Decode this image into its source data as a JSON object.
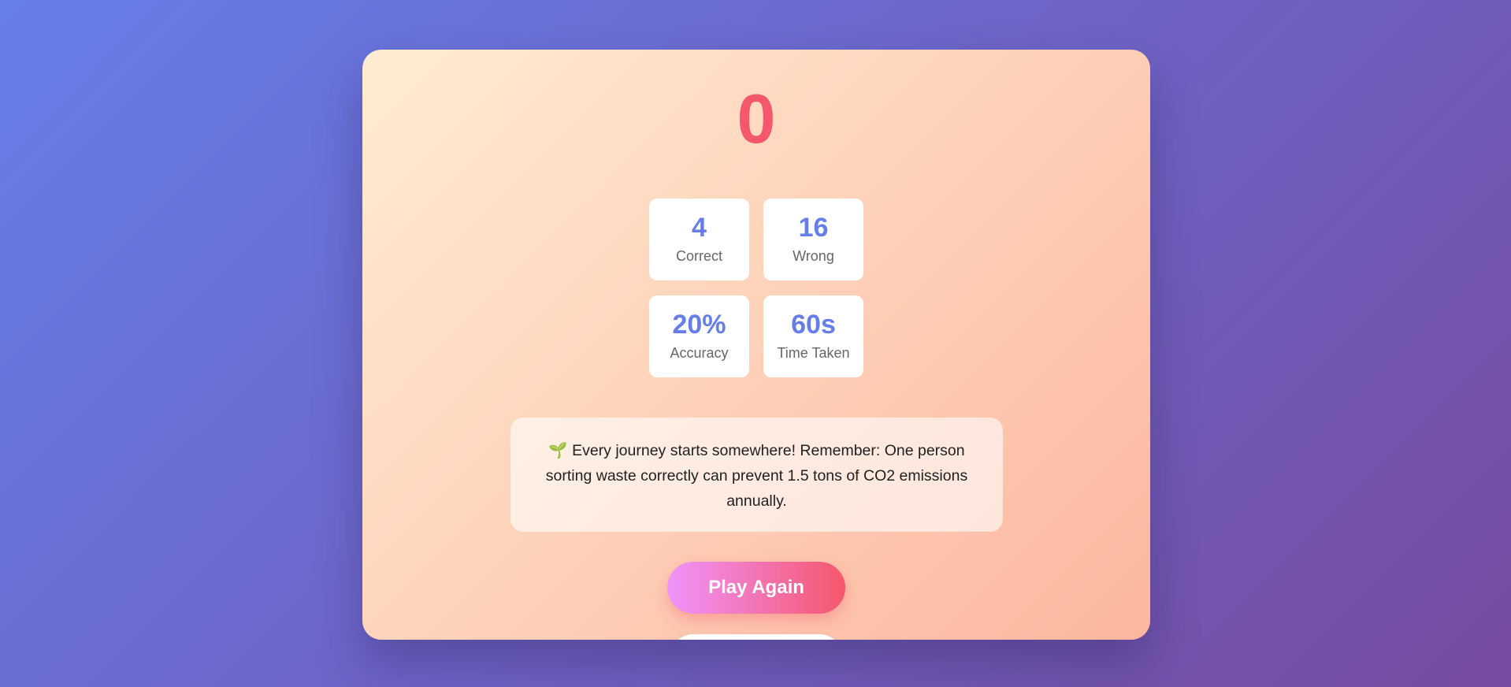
{
  "results": {
    "score": "0",
    "stats": [
      {
        "value": "4",
        "label": "Correct"
      },
      {
        "value": "16",
        "label": "Wrong"
      },
      {
        "value": "20%",
        "label": "Accuracy"
      },
      {
        "value": "60s",
        "label": "Time Taken"
      }
    ],
    "message": "🌱 Every journey starts somewhere! Remember: One person sorting waste correctly can prevent 1.5 tons of CO2 emissions annually."
  },
  "actions": {
    "play_again_label": "Play Again"
  },
  "colors": {
    "score": "#f5576c",
    "stat_value": "#667eea",
    "accent_gradient_start": "#f093fb",
    "accent_gradient_end": "#f5576c"
  }
}
